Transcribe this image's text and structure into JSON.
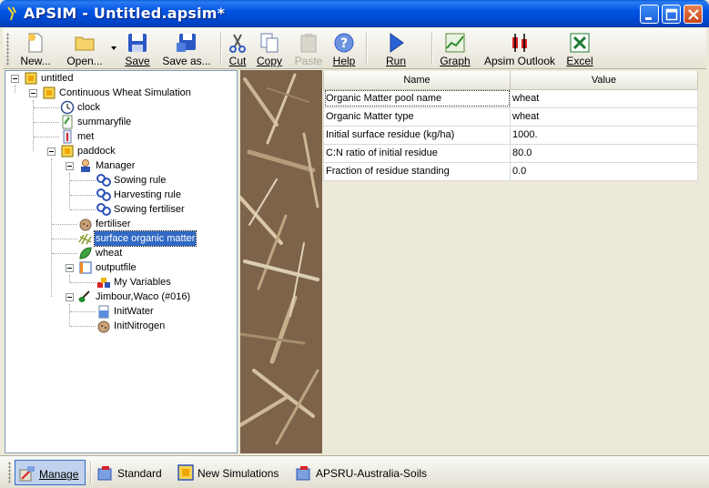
{
  "window": {
    "title": "APSIM - Untitled.apsim*"
  },
  "toolbar": {
    "new_label": "New...",
    "open_label": "Open...",
    "save_label": "Save",
    "saveas_label": "Save as...",
    "cut_label": "Cut",
    "copy_label": "Copy",
    "paste_label": "Paste",
    "help_label": "Help",
    "run_label": "Run",
    "graph_label": "Graph",
    "outlook_label": "Apsim Outlook",
    "excel_label": "Excel"
  },
  "tree": {
    "items": [
      {
        "label": "untitled",
        "icon": "folder-node-icon"
      },
      {
        "label": "Continuous Wheat Simulation",
        "icon": "simulation-icon"
      },
      {
        "label": "clock",
        "icon": "clock-icon"
      },
      {
        "label": "summaryfile",
        "icon": "summary-file-icon"
      },
      {
        "label": "met",
        "icon": "thermometer-icon"
      },
      {
        "label": "paddock",
        "icon": "paddock-icon"
      },
      {
        "label": "Manager",
        "icon": "manager-icon"
      },
      {
        "label": "Sowing rule",
        "icon": "rule-icon"
      },
      {
        "label": "Harvesting rule",
        "icon": "rule-icon"
      },
      {
        "label": "Sowing fertiliser",
        "icon": "rule-icon"
      },
      {
        "label": "fertiliser",
        "icon": "fertiliser-bag-icon"
      },
      {
        "label": "surface organic matter",
        "icon": "surface-organic-matter-icon"
      },
      {
        "label": "wheat",
        "icon": "wheat-leaf-icon"
      },
      {
        "label": "outputfile",
        "icon": "output-file-icon"
      },
      {
        "label": "My Variables",
        "icon": "variables-icon"
      },
      {
        "label": "Jimbour,Waco (#016)",
        "icon": "soil-shovel-icon"
      },
      {
        "label": "InitWater",
        "icon": "water-beaker-icon"
      },
      {
        "label": "InitNitrogen",
        "icon": "nitrogen-bag-icon"
      }
    ],
    "selected": "surface organic matter"
  },
  "grid": {
    "headers": [
      "Name",
      "Value"
    ],
    "rows": [
      {
        "name": "Organic Matter pool name",
        "value": "wheat"
      },
      {
        "name": "Organic Matter type",
        "value": "wheat"
      },
      {
        "name": "Initial surface residue (kg/ha)",
        "value": "1000."
      },
      {
        "name": "C:N ratio of initial residue",
        "value": "80.0"
      },
      {
        "name": "Fraction of residue standing",
        "value": "0.0"
      }
    ]
  },
  "bottombar": {
    "manage_label": "Manage",
    "standard_label": "Standard",
    "new_sims_label": "New Simulations",
    "apsru_label": "APSRU-Australia-Soils"
  },
  "colors": {
    "titlebar": "#0054E3",
    "selection": "#316AC5",
    "chrome": "#ECE9D8"
  }
}
